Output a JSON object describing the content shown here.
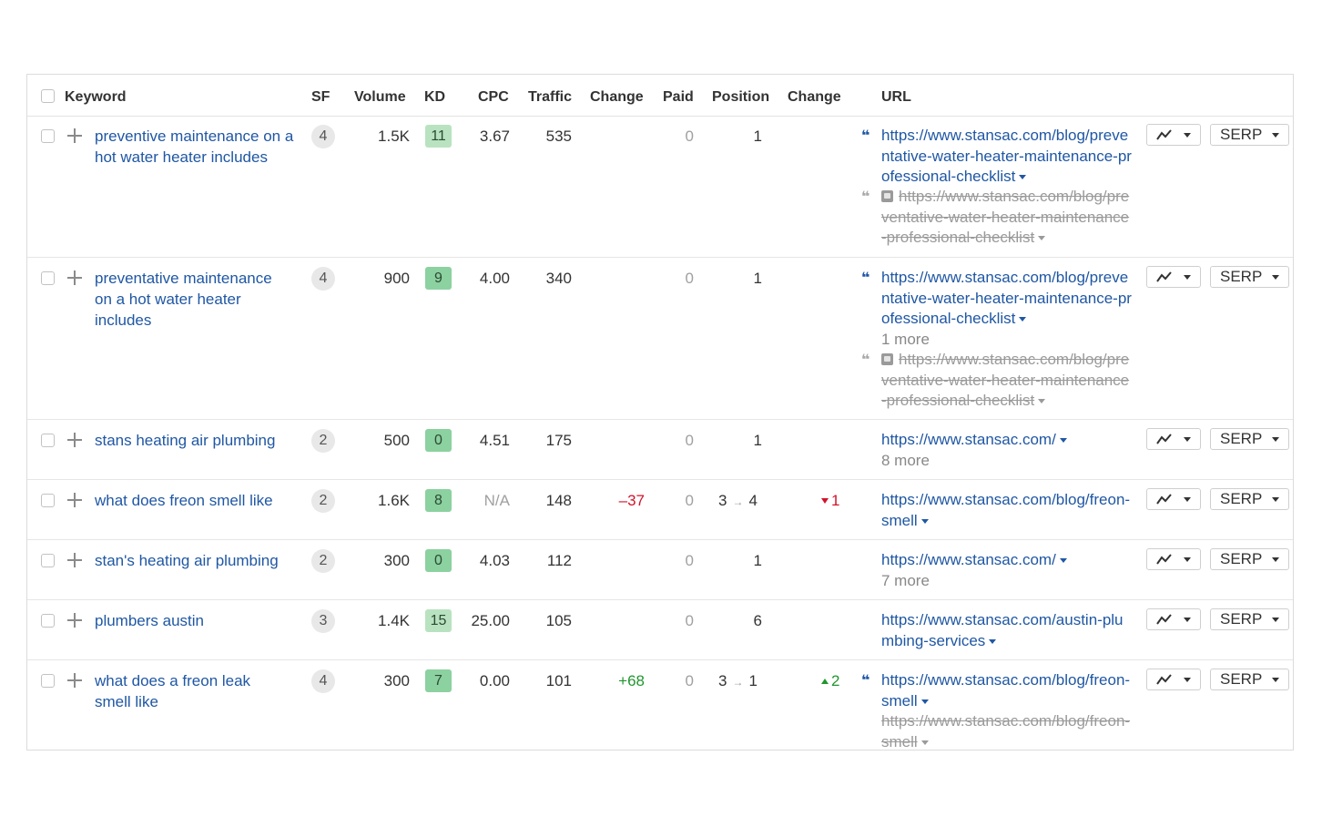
{
  "header": {
    "keyword": "Keyword",
    "sf": "SF",
    "volume": "Volume",
    "kd": "KD",
    "cpc": "CPC",
    "traffic": "Traffic",
    "change": "Change",
    "paid": "Paid",
    "position": "Position",
    "position_change": "Change",
    "url": "URL"
  },
  "colors": {
    "link": "#1f57a4",
    "kd_dark_green": "#8cd1a0",
    "kd_light_green": "#b9e3c0",
    "negative": "#d0142a",
    "positive": "#20962e"
  },
  "buttons": {
    "chart_icon": "trend-chart-icon",
    "serp_label": "SERP"
  },
  "rows": [
    {
      "keyword": "preventive maintenance on a hot water heater includes",
      "sf": "4",
      "volume": "1.5K",
      "kd": "11",
      "cpc": "3.67",
      "traffic": "535",
      "change": "",
      "paid": "0",
      "position_from": "",
      "position": "1",
      "position_change": "",
      "url": "https://www.stansac.com/blog/preventative-water-heater-maintenance-professional-checklist",
      "more": "",
      "old_url": "https://www.stansac.com/blog/preventative-water-heater-maintenance-professional-checklist"
    },
    {
      "keyword": "preventative maintenance on a hot water heater includes",
      "sf": "4",
      "volume": "900",
      "kd": "9",
      "cpc": "4.00",
      "traffic": "340",
      "change": "",
      "paid": "0",
      "position_from": "",
      "position": "1",
      "position_change": "",
      "url": "https://www.stansac.com/blog/preventative-water-heater-maintenance-professional-checklist",
      "more": "1 more",
      "old_url": "https://www.stansac.com/blog/preventative-water-heater-maintenance-professional-checklist"
    },
    {
      "keyword": "stans heating air plumbing",
      "sf": "2",
      "volume": "500",
      "kd": "0",
      "cpc": "4.51",
      "traffic": "175",
      "change": "",
      "paid": "0",
      "position_from": "",
      "position": "1",
      "position_change": "",
      "url": "https://www.stansac.com/",
      "more": "8 more",
      "old_url": ""
    },
    {
      "keyword": "what does freon smell like",
      "sf": "2",
      "volume": "1.6K",
      "kd": "8",
      "cpc": "N/A",
      "traffic": "148",
      "change": "–37",
      "paid": "0",
      "position_from": "3",
      "position": "4",
      "position_change": "1",
      "url": "https://www.stansac.com/blog/freon-smell",
      "more": "",
      "old_url": ""
    },
    {
      "keyword": "stan's heating air plumbing",
      "sf": "2",
      "volume": "300",
      "kd": "0",
      "cpc": "4.03",
      "traffic": "112",
      "change": "",
      "paid": "0",
      "position_from": "",
      "position": "1",
      "position_change": "",
      "url": "https://www.stansac.com/",
      "more": "7 more",
      "old_url": ""
    },
    {
      "keyword": "plumbers austin",
      "sf": "3",
      "volume": "1.4K",
      "kd": "15",
      "cpc": "25.00",
      "traffic": "105",
      "change": "",
      "paid": "0",
      "position_from": "",
      "position": "6",
      "position_change": "",
      "url": "https://www.stansac.com/austin-plumbing-services",
      "more": "",
      "old_url": ""
    },
    {
      "keyword": "what does a freon leak smell like",
      "sf": "4",
      "volume": "300",
      "kd": "7",
      "cpc": "0.00",
      "traffic": "101",
      "change": "+68",
      "paid": "0",
      "position_from": "3",
      "position": "1",
      "position_change": "2",
      "url": "https://www.stansac.com/blog/freon-smell",
      "more": "",
      "old_url": "https://www.stansac.com/blog/freon-smell"
    }
  ]
}
